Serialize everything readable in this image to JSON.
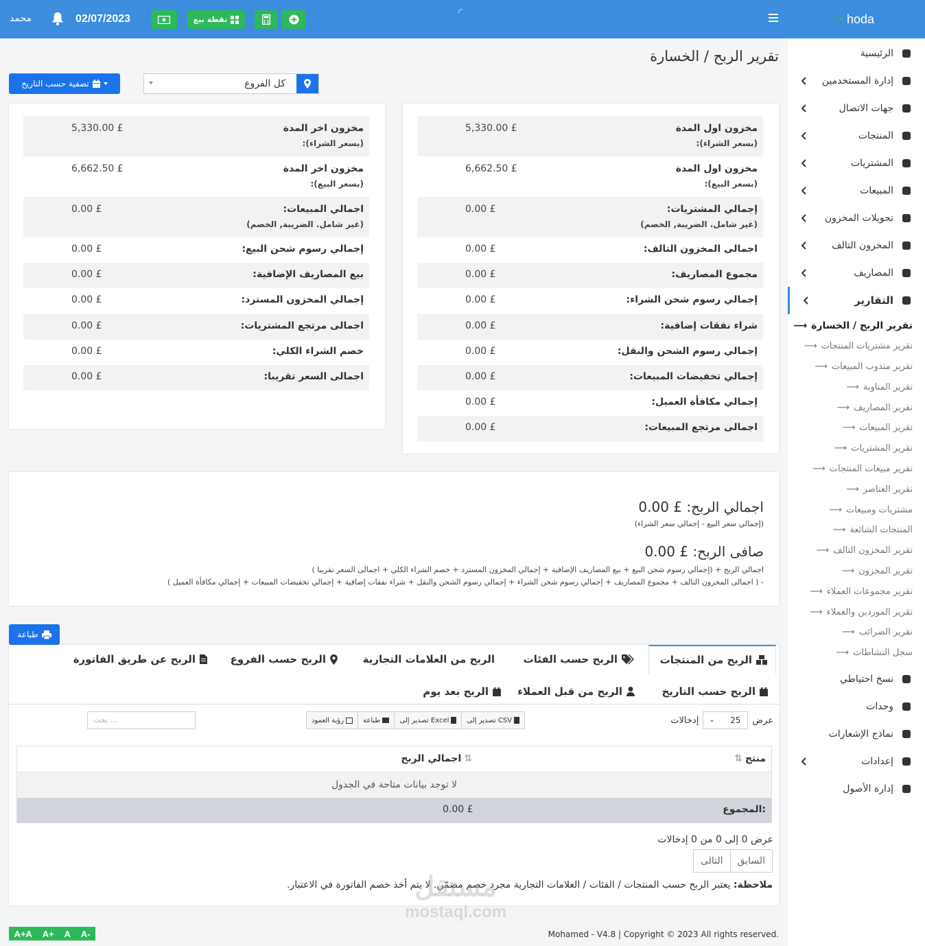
{
  "header": {
    "user_name": "محمد",
    "date": "02/07/2023",
    "pos_label": "نقطة بيع"
  },
  "sidebar": {
    "brand": "hoda",
    "items": [
      {
        "label": "الرئيسية",
        "icon": "dashboard-icon",
        "chevron": false
      },
      {
        "label": "إدارة المستخدمين",
        "icon": "users-icon",
        "chevron": true
      },
      {
        "label": "جهات الاتصال",
        "icon": "contact-card-icon",
        "chevron": true
      },
      {
        "label": "المنتجات",
        "icon": "cubes-icon",
        "chevron": true
      },
      {
        "label": "المشتريات",
        "icon": "arrow-down-circle-icon",
        "chevron": true
      },
      {
        "label": "المبيعات",
        "icon": "arrow-up-circle-icon",
        "chevron": true
      },
      {
        "label": "تحويلات المخزون",
        "icon": "truck-icon",
        "chevron": true
      },
      {
        "label": "المخزون التالف",
        "icon": "database-icon",
        "chevron": true
      },
      {
        "label": "المصاريف",
        "icon": "minus-circle-icon",
        "chevron": true
      },
      {
        "label": "التقارير",
        "icon": "bar-chart-icon",
        "chevron": true
      }
    ],
    "sub_items": [
      "تقرير الربح / الخسارة",
      "تقرير مشتريات المنتجات",
      "تقرير مندوب المبيعات",
      "تقرير المناوبة",
      "تقرير المصاريف",
      "تقرير المبيعات",
      "تقرير المشتريات",
      "تقرير مبيعات المنتجات",
      "تقرير العناصر",
      "مشتريات ومبيعات",
      "المنتجات الشائعة",
      "تقرير المخزون التالف",
      "تقرير المخزون",
      "تقرير مجموعات العملاء",
      "تقرير الموردين والعملاء",
      "تقرير الضرائب",
      "سجل النشاطات"
    ],
    "bottom_items": [
      {
        "label": "نسخ احتياطي",
        "icon": "hdd-icon",
        "chevron": false
      },
      {
        "label": "وحدات",
        "icon": "plug-icon",
        "chevron": false
      },
      {
        "label": "نماذج الإشعارات",
        "icon": "envelope-icon",
        "chevron": false
      },
      {
        "label": "إعدادات",
        "icon": "gear-icon",
        "chevron": true
      },
      {
        "label": "إدارة الأصول",
        "icon": "sitemap-icon",
        "chevron": false
      }
    ]
  },
  "page": {
    "title": "تقرير الربح / الخسارة",
    "filter_date": "تصفية حسب التاريخ",
    "branch_value": "كل الفروع"
  },
  "left_card": [
    {
      "label": "مخزون اخر المدة",
      "sub": "(بسعر الشراء):",
      "value": "5,330.00 £"
    },
    {
      "label": "مخزون اخر المدة",
      "sub": "(بسعر البيع):",
      "value": "6,662.50 £"
    },
    {
      "label": "اجمالي المبيعات:",
      "sub": "(غير شامل. الضريبة, الخصم)",
      "value": "0.00 £"
    },
    {
      "label": "إجمالي رسوم شحن البيع:",
      "sub": "",
      "value": "0.00 £"
    },
    {
      "label": "بيع المصاريف الإضافية:",
      "sub": "",
      "value": "0.00 £"
    },
    {
      "label": "إجمالي المخزون المسترد:",
      "sub": "",
      "value": "0.00 £"
    },
    {
      "label": "اجمالى مرتجع المشتريات:",
      "sub": "",
      "value": "0.00 £"
    },
    {
      "label": "خصم الشراء الكلي:",
      "sub": "",
      "value": "0.00 £"
    },
    {
      "label": "اجمالى السعر تقريبا:",
      "sub": "",
      "value": "0.00 £"
    }
  ],
  "right_card": [
    {
      "label": "مخزون اول المدة",
      "sub": "(بسعر الشراء):",
      "value": "5,330.00 £"
    },
    {
      "label": "مخزون اول المدة",
      "sub": "(بسعر البيع):",
      "value": "6,662.50 £"
    },
    {
      "label": "إجمالي المشتريات:",
      "sub": "(غير شامل. الضريبة, الخصم)",
      "value": "0.00 £"
    },
    {
      "label": "اجمالى المخزون التالف:",
      "sub": "",
      "value": "0.00 £"
    },
    {
      "label": "مجموع المصاريف:",
      "sub": "",
      "value": "0.00 £"
    },
    {
      "label": "إجمالي رسوم شحن الشراء:",
      "sub": "",
      "value": "0.00 £"
    },
    {
      "label": "شراء نفقات إضافية:",
      "sub": "",
      "value": "0.00 £"
    },
    {
      "label": "إجمالي رسوم الشحن والنقل:",
      "sub": "",
      "value": "0.00 £"
    },
    {
      "label": "إجمالي تخفيضات المبيعات:",
      "sub": "",
      "value": "0.00 £"
    },
    {
      "label": "إجمالي مكافأة العميل:",
      "sub": "",
      "value": "0.00 £"
    },
    {
      "label": "اجمالى مرتجع المبيعات:",
      "sub": "",
      "value": "0.00 £"
    }
  ],
  "totals": {
    "gross_label": "اجمالي الربح: £ 0.00",
    "gross_formula": "(إجمالي سعر البيع - إجمالي سعر الشراء)",
    "net_label": "صافى الربح: £ 0.00",
    "net_formula_1": "اجمالي الربح + (إجمالي رسوم شحن البيع + بيع المصاريف الإضافية + إجمالي المخزون المسترد + خصم الشراء الكلي + اجمالى السعر تقريبا )",
    "net_formula_2": "- ( اجمالى المخزون التالف + مجموع المصاريف + إجمالي رسوم شحن الشراء + إجمالي رسوم الشحن والنقل + شراء نفقات إضافية + إجمالي تخفيضات المبيعات + إجمالي مكافأة العميل )"
  },
  "print_label": "طباعة",
  "tabs": [
    "الربح من المنتجات",
    "الربح حسب الفئات",
    "الربح من العلامات التجارية",
    "الربح حسب الفروع",
    "الربح عن طريق الفاتورة",
    "الربح حسب التاريخ",
    "الربح من قبل العملاء",
    "الربح بعد يوم"
  ],
  "datatable": {
    "show_label": "عرض",
    "entries_label": "إدخالات",
    "page_length": "25",
    "btn_csv": "تصدير إلى CSV",
    "btn_excel": "تصدير إلى Excel",
    "btn_print": "طباعة",
    "btn_columns": "رؤية العمود",
    "search_placeholder": "بحث ...",
    "col_product": "منتج",
    "col_profit": "اجمالي الربح",
    "empty": "لا توجد بيانات متاحة في الجدول",
    "total_label": "المجموع:",
    "total_value": "0.00 £",
    "info": "عرض 0 إلى 0 من 0 إدخالات",
    "prev": "السابق",
    "next": "التالى",
    "note_bold": "ملاحظة:",
    "note_text": "يعتبر الربح حسب المنتجات / الفئات / العلامات التجارية مجرد خصم مضمّن. لا يتم أخذ خصم الفاتورة في الاعتبار."
  },
  "footer": {
    "copyright": "Mohamed - V4.8 | Copyright © 2023 All rights reserved.",
    "font_sizes": [
      "A+A",
      "A+",
      "A",
      "A-"
    ]
  },
  "watermark": {
    "ar": "مستقل",
    "en": "mostaql.com"
  },
  "colors": {
    "primary": "#3c8dde",
    "button": "#1a73e8",
    "success": "#2eb85c"
  }
}
